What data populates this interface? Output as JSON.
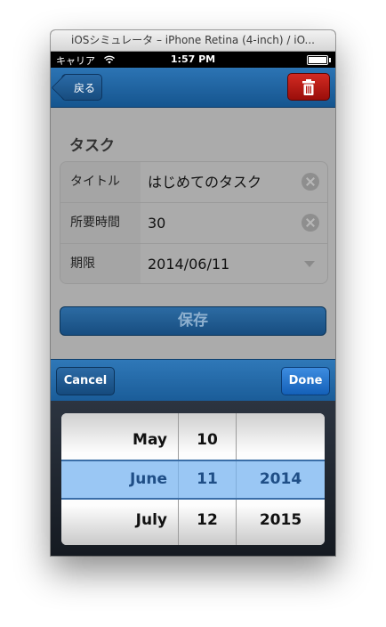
{
  "window": {
    "title": "iOSシミュレータ – iPhone Retina (4-inch) / iO..."
  },
  "status_bar": {
    "carrier": "キャリア",
    "time": "1:57 PM"
  },
  "nav": {
    "back_label": "戻る"
  },
  "form": {
    "section_title": "タスク",
    "rows": [
      {
        "label": "タイトル",
        "value": "はじめてのタスク"
      },
      {
        "label": "所要時間",
        "value": "30"
      },
      {
        "label": "期限",
        "value": "2014/06/11"
      }
    ],
    "save_label": "保存"
  },
  "picker_toolbar": {
    "cancel_label": "Cancel",
    "done_label": "Done"
  },
  "date_picker": {
    "months": [
      "May",
      "June",
      "July"
    ],
    "days": [
      "10",
      "11",
      "12"
    ],
    "years": [
      "",
      "2014",
      "2015"
    ],
    "selected": {
      "month": "June",
      "day": "11",
      "year": "2014"
    }
  },
  "colors": {
    "nav_bar": "#15558f",
    "trash_button": "#c0201a",
    "selection_highlight": "#7ab6ee"
  }
}
